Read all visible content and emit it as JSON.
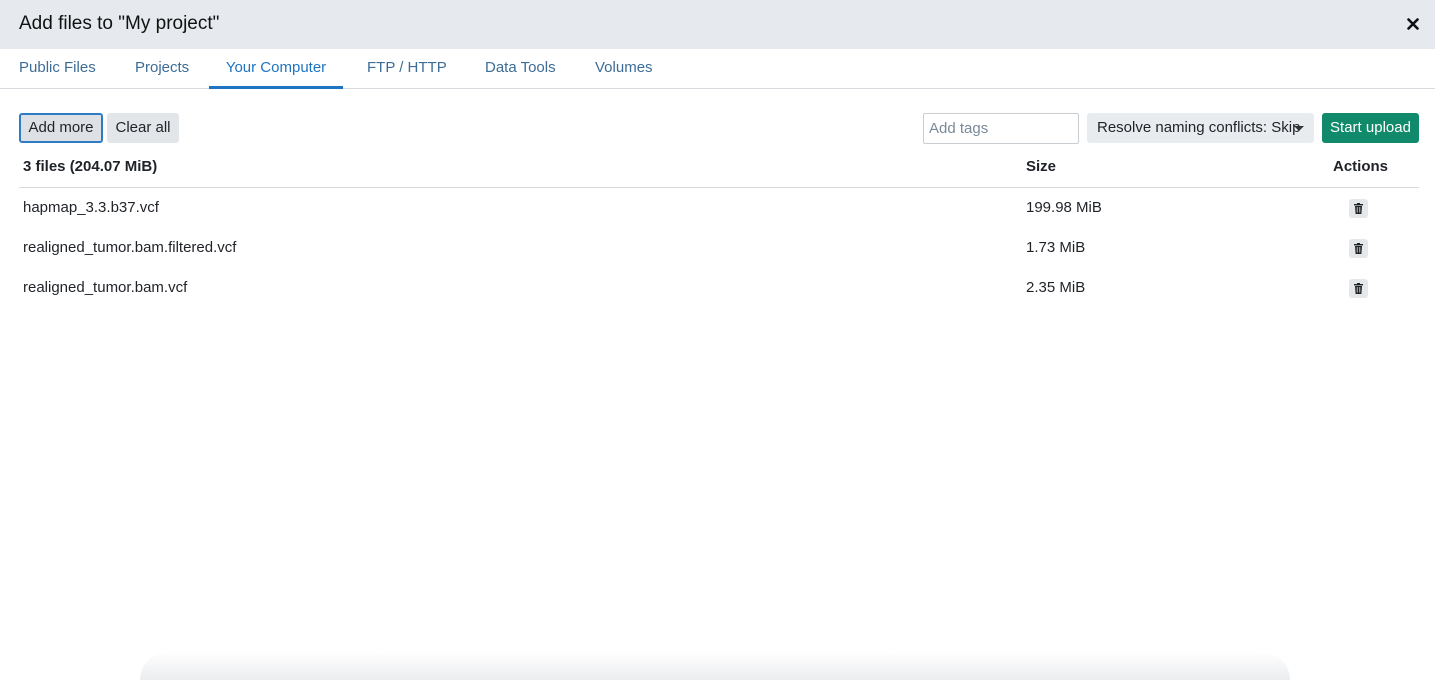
{
  "header": {
    "title": "Add files to \"My project\"",
    "close_icon": "close-icon"
  },
  "tabs": [
    {
      "label": "Public Files",
      "active": false
    },
    {
      "label": "Projects",
      "active": false
    },
    {
      "label": "Your Computer",
      "active": true
    },
    {
      "label": "FTP / HTTP",
      "active": false
    },
    {
      "label": "Data Tools",
      "active": false
    },
    {
      "label": "Volumes",
      "active": false
    }
  ],
  "toolbar": {
    "add_more_label": "Add more",
    "clear_all_label": "Clear all",
    "tags_placeholder": "Add tags",
    "tags_value": "",
    "resolve_label": "Resolve naming conflicts: Skip",
    "upload_label": "Start upload"
  },
  "table": {
    "summary": "3 files (204.07 MiB)",
    "size_header": "Size",
    "actions_header": "Actions",
    "rows": [
      {
        "name": "hapmap_3.3.b37.vcf",
        "size": "199.98 MiB"
      },
      {
        "name": "realigned_tumor.bam.filtered.vcf",
        "size": "1.73 MiB"
      },
      {
        "name": "realigned_tumor.bam.vcf",
        "size": "2.35 MiB"
      }
    ],
    "row_action_icon": "trash-icon"
  },
  "colors": {
    "accent": "#1f74c1",
    "upload_button": "#118a6b",
    "header_bg": "#e6eaee"
  }
}
